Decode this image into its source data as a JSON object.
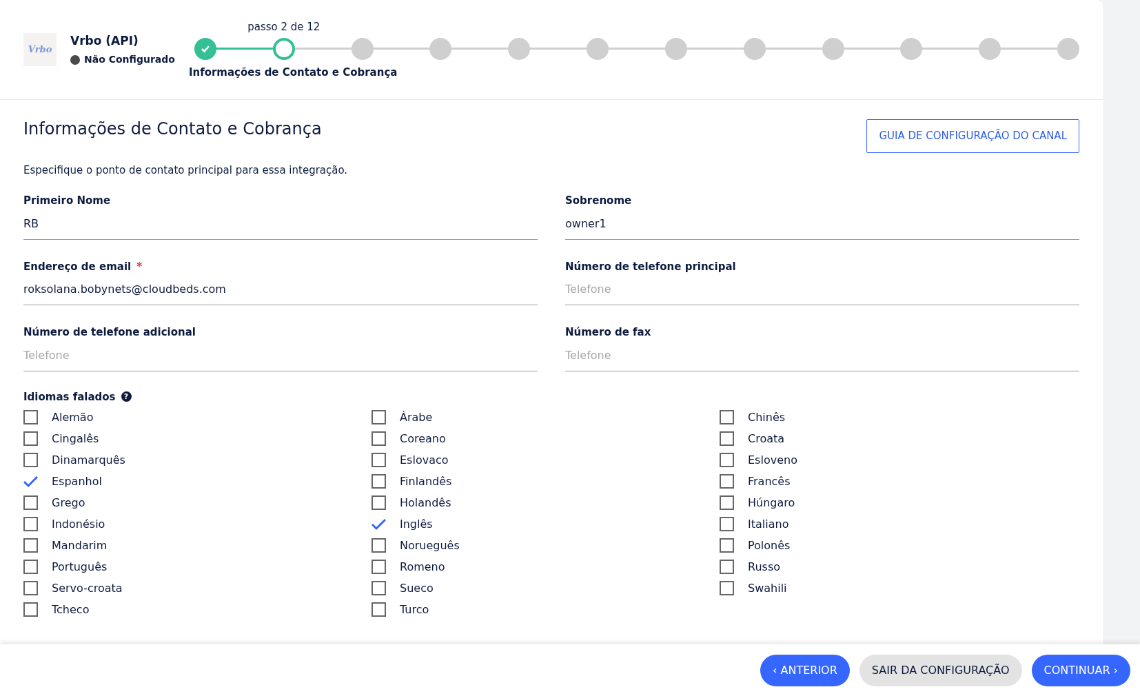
{
  "channel": {
    "name": "Vrbo (API)",
    "logo_text": "Vrbo",
    "status": "Não Configurado"
  },
  "stepper": {
    "caption": "passo 2 de 12",
    "current_label": "Informações de Contato e Cobrança",
    "steps": [
      {
        "completed": true,
        "selected": false
      },
      {
        "completed": false,
        "selected": true
      },
      {
        "completed": false,
        "selected": false
      },
      {
        "completed": false,
        "selected": false
      },
      {
        "completed": false,
        "selected": false
      },
      {
        "completed": false,
        "selected": false
      },
      {
        "completed": false,
        "selected": false
      },
      {
        "completed": false,
        "selected": false
      },
      {
        "completed": false,
        "selected": false
      },
      {
        "completed": false,
        "selected": false
      },
      {
        "completed": false,
        "selected": false
      },
      {
        "completed": false,
        "selected": false
      }
    ]
  },
  "section": {
    "title": "Informações de Contato e Cobrança",
    "guide_button": "GUIA DE CONFIGURAÇÃO DO CANAL",
    "description": "Especifique o ponto de contato principal para essa integração."
  },
  "fields": [
    {
      "label": "Primeiro Nome",
      "value": "RB"
    },
    {
      "label": "Sobrenome",
      "value": "owner1"
    },
    {
      "label": "Endereço de email",
      "value": "roksolana.bobynets@cloudbeds.com",
      "required_mark": "*"
    },
    {
      "label": "Número de telefone principal",
      "placeholder": "Telefone"
    },
    {
      "label": "Número de telefone adicional",
      "placeholder": "Telefone"
    },
    {
      "label": "Número de fax",
      "placeholder": "Telefone"
    }
  ],
  "languages": {
    "label": "Idiomas falados",
    "help_icon": "?",
    "columns": [
      [
        {
          "label": "Alemão",
          "checked": false
        },
        {
          "label": "Cingalês",
          "checked": false
        },
        {
          "label": "Dinamarquês",
          "checked": false
        },
        {
          "label": "Espanhol",
          "checked": true
        },
        {
          "label": "Grego",
          "checked": false
        },
        {
          "label": "Indonésio",
          "checked": false
        },
        {
          "label": "Mandarim",
          "checked": false
        },
        {
          "label": "Português",
          "checked": false
        },
        {
          "label": "Servo-croata",
          "checked": false
        },
        {
          "label": "Tcheco",
          "checked": false
        }
      ],
      [
        {
          "label": "Árabe",
          "checked": false
        },
        {
          "label": "Coreano",
          "checked": false
        },
        {
          "label": "Eslovaco",
          "checked": false
        },
        {
          "label": "Finlandês",
          "checked": false
        },
        {
          "label": "Holandês",
          "checked": false
        },
        {
          "label": "Inglês",
          "checked": true
        },
        {
          "label": "Norueguês",
          "checked": false
        },
        {
          "label": "Romeno",
          "checked": false
        },
        {
          "label": "Sueco",
          "checked": false
        },
        {
          "label": "Turco",
          "checked": false
        }
      ],
      [
        {
          "label": "Chinês",
          "checked": false
        },
        {
          "label": "Croata",
          "checked": false
        },
        {
          "label": "Esloveno",
          "checked": false
        },
        {
          "label": "Francês",
          "checked": false
        },
        {
          "label": "Húngaro",
          "checked": false
        },
        {
          "label": "Italiano",
          "checked": false
        },
        {
          "label": "Polonês",
          "checked": false
        },
        {
          "label": "Russo",
          "checked": false
        },
        {
          "label": "Swahili",
          "checked": false
        }
      ]
    ]
  },
  "footer": {
    "buttons": [
      {
        "kind": "back",
        "label": "ANTERIOR",
        "icon": "‹"
      },
      {
        "kind": "exit",
        "label": "SAIR DA CONFIGURAÇÃO"
      },
      {
        "kind": "next",
        "label": "CONTINUAR",
        "icon": "›"
      }
    ]
  }
}
